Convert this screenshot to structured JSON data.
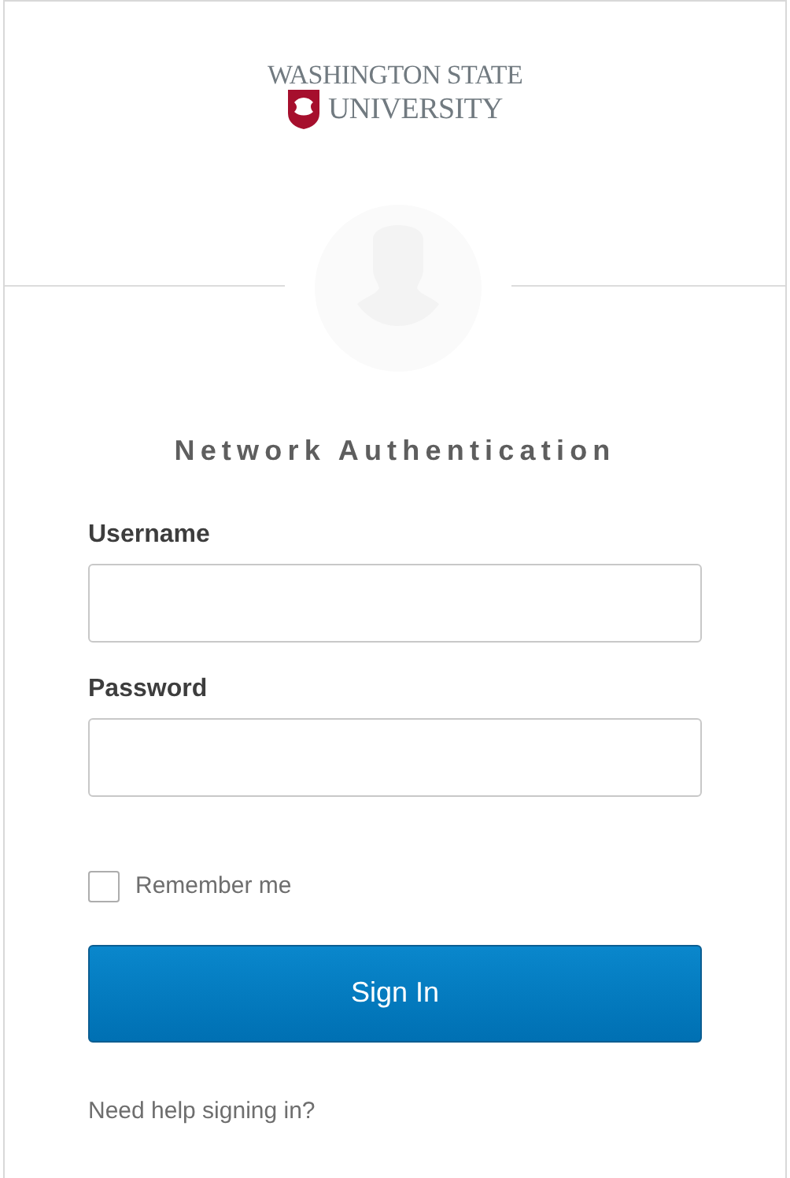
{
  "logo": {
    "line_1": "WASHINGTON STATE",
    "line_2": "UNIVERSITY"
  },
  "title": "Network Authentication",
  "fields": [
    {
      "label": "Username"
    },
    {
      "label": "Password"
    }
  ],
  "remember": {
    "label": "Remember me",
    "checked": false
  },
  "button": "Sign In",
  "help_link": "Need help signing in?"
}
